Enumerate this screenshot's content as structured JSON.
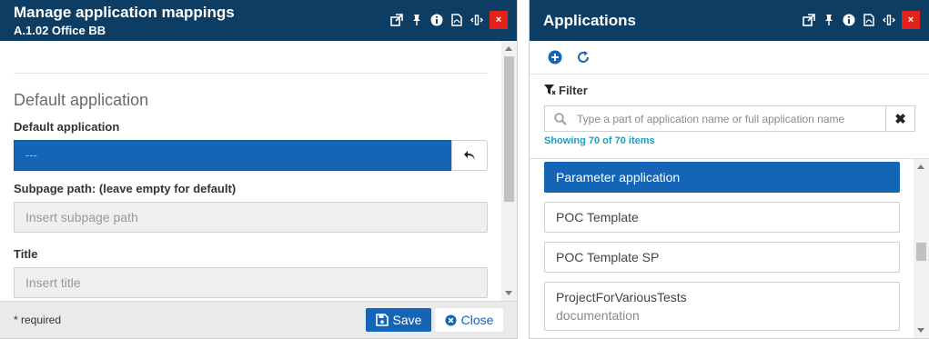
{
  "left_panel": {
    "title": "Manage application mappings",
    "subtitle": "A.1.02 Office BB",
    "header_icons": [
      "popout-icon",
      "pin-icon",
      "info-icon",
      "pdf-icon",
      "resize-icon",
      "close-icon"
    ],
    "close_glyph": "×",
    "section_title": "Default application",
    "default_app_label": "Default application",
    "default_app_value": "---",
    "subpage_label": "Subpage path: (leave empty for default)",
    "subpage_placeholder": "Insert subpage path",
    "title_label": "Title",
    "title_placeholder": "Insert title",
    "required_note": "* required",
    "save_label": "Save",
    "close_label": "Close"
  },
  "right_panel": {
    "title": "Applications",
    "close_glyph": "×",
    "filter_label": "Filter",
    "search_placeholder": "Type a part of application name or full application name",
    "clear_glyph": "✖",
    "showing_text": "Showing 70 of 70 items",
    "items": [
      {
        "label": "Parameter application",
        "sub": "",
        "selected": true
      },
      {
        "label": "POC Template",
        "sub": "",
        "selected": false
      },
      {
        "label": "POC Template SP",
        "sub": "",
        "selected": false
      },
      {
        "label": "ProjectForVariousTests",
        "sub": "documentation",
        "selected": false
      }
    ]
  },
  "colors": {
    "header_bg": "#0d3d63",
    "accent_blue": "#1565b7",
    "close_red": "#e2231a",
    "showing_text": "#1b9fbf"
  }
}
